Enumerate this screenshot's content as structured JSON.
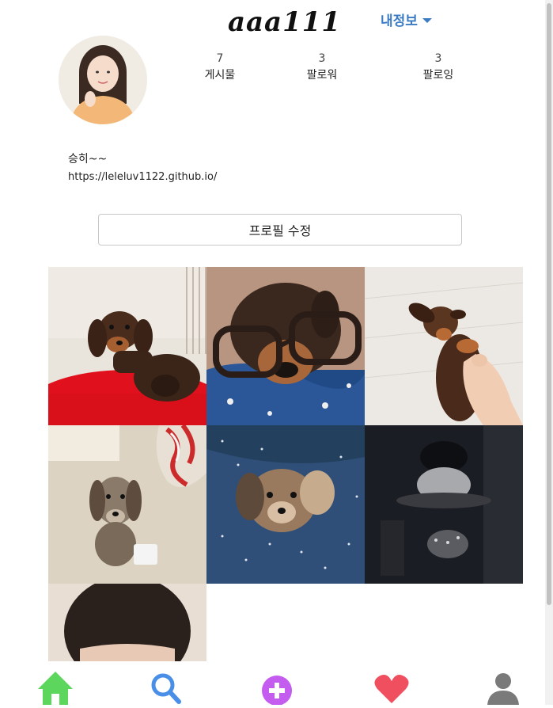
{
  "profile": {
    "username": "aaa111",
    "menu_label": "내정보",
    "bio_name": "승히~~",
    "website": "https://leleluv1122.github.io/"
  },
  "stats": [
    {
      "count": "7",
      "label": "게시물"
    },
    {
      "count": "3",
      "label": "팔로워"
    },
    {
      "count": "3",
      "label": "팔로잉"
    }
  ],
  "actions": {
    "edit_profile": "프로필 수정"
  },
  "posts": [
    {
      "subject": "dachshund puppy on red cushion"
    },
    {
      "subject": "dachshund puppy wearing glasses"
    },
    {
      "subject": "dachshund puppy with hand"
    },
    {
      "subject": "dapple dachshund puppy sitting"
    },
    {
      "subject": "dapple dachshund puppy lying on blanket"
    },
    {
      "subject": "dark cafe interior"
    },
    {
      "subject": "person haircut close-up"
    }
  ],
  "nav": {
    "icons": [
      "home-icon",
      "search-icon",
      "add-post-icon",
      "heart-icon",
      "profile-icon"
    ],
    "colors": {
      "home": "#5cd65c",
      "search": "#4a8fe7",
      "add": "#c45cf0",
      "heart": "#ef4f5f",
      "profile": "#7a7a7a"
    }
  },
  "colors": {
    "accent": "#3b7bc4",
    "button_border": "#c8c8c8"
  }
}
